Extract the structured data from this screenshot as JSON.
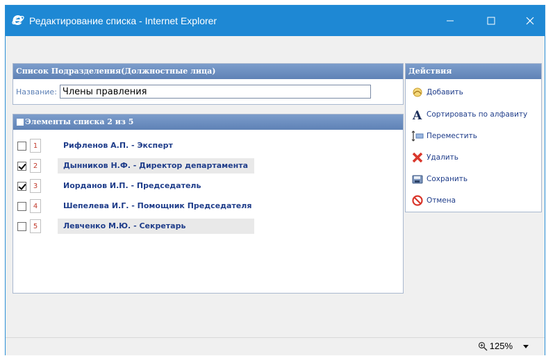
{
  "window": {
    "title": "Редактирование списка - Internet Explorer",
    "accent_color": "#1e88d4"
  },
  "list_panel": {
    "header": "Список Подразделения(Должностные лица)",
    "name_label": "Название:",
    "name_value": "Члены правления"
  },
  "elements": {
    "header": "Элементы списка 2 из 5",
    "items": [
      {
        "num": "1",
        "text": "Рифленов А.П. - Эксперт",
        "checked": false
      },
      {
        "num": "2",
        "text": "Дынников Н.Ф. - Директор департамента",
        "checked": true
      },
      {
        "num": "3",
        "text": "Иорданов И.П. - Председатель",
        "checked": true
      },
      {
        "num": "4",
        "text": "Шепелева И.Г. - Помощник Председателя",
        "checked": false
      },
      {
        "num": "5",
        "text": "Левченко М.Ю. - Секретарь",
        "checked": false
      }
    ]
  },
  "actions": {
    "header": "Действия",
    "items": [
      {
        "label": "Добавить",
        "icon": "add-icon"
      },
      {
        "label": "Сортировать по алфавиту",
        "icon": "sort-alpha-icon"
      },
      {
        "label": "Переместить",
        "icon": "move-icon"
      },
      {
        "label": "Удалить",
        "icon": "delete-icon"
      },
      {
        "label": "Сохранить",
        "icon": "save-icon"
      },
      {
        "label": "Отмена",
        "icon": "cancel-icon"
      }
    ]
  },
  "statusbar": {
    "zoom": "125%"
  }
}
